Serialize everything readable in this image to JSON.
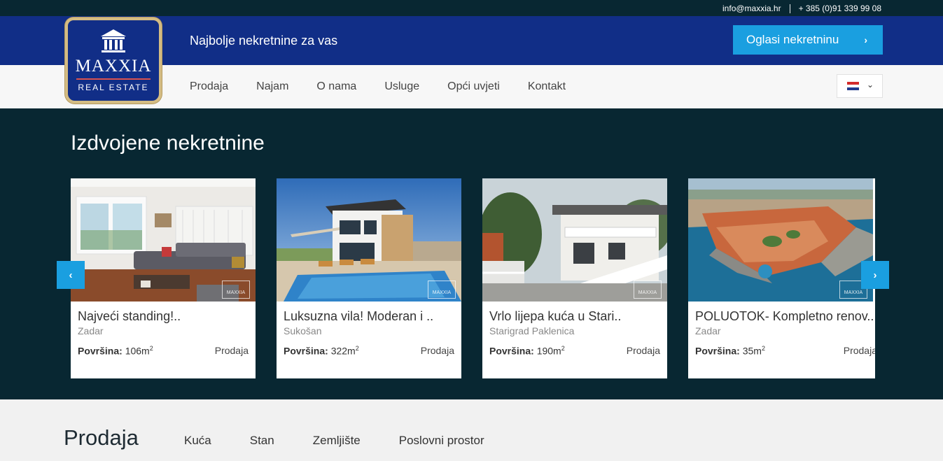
{
  "topbar": {
    "email": "info@maxxia.hr",
    "phone": "+ 385 (0)91 339 99 08"
  },
  "header": {
    "logo": {
      "brand": "MAXXIA",
      "subtitle": "REAL ESTATE"
    },
    "tagline": "Najbolje nekretnine za vas",
    "cta_label": "Oglasi nekretninu",
    "cta_icon": "chevron-right-icon"
  },
  "nav": {
    "items": [
      "Prodaja",
      "Najam",
      "O nama",
      "Usluge",
      "Opći uvjeti",
      "Kontakt"
    ],
    "language": {
      "flag": "croatia",
      "icon": "chevron-down-icon"
    }
  },
  "featured": {
    "heading": "Izdvojene nekretnine",
    "area_label": "Površina:",
    "cards": [
      {
        "title": "Najveći standing!..",
        "location": "Zadar",
        "area": "106m",
        "unit_sup": "2",
        "type": "Prodaja"
      },
      {
        "title": "Luksuzna vila! Moderan i ..",
        "location": "Sukošan",
        "area": "322m",
        "unit_sup": "2",
        "type": "Prodaja"
      },
      {
        "title": "Vrlo lijepa kuća u Stari..",
        "location": "Starigrad Paklenica",
        "area": "190m",
        "unit_sup": "2",
        "type": "Prodaja"
      },
      {
        "title": "POLUOTOK- Kompletno renov..",
        "location": "Zadar",
        "area": "35m",
        "unit_sup": "2",
        "type": "Prodaja"
      }
    ],
    "watermark": "MAXXIA"
  },
  "sale": {
    "heading": "Prodaja",
    "categories": [
      "Kuća",
      "Stan",
      "Zemljište",
      "Poslovni prostor"
    ]
  },
  "colors": {
    "dark": "#082732",
    "brand_blue": "#112e87",
    "accent": "#1a9fe0",
    "gold": "#d4bc83"
  }
}
